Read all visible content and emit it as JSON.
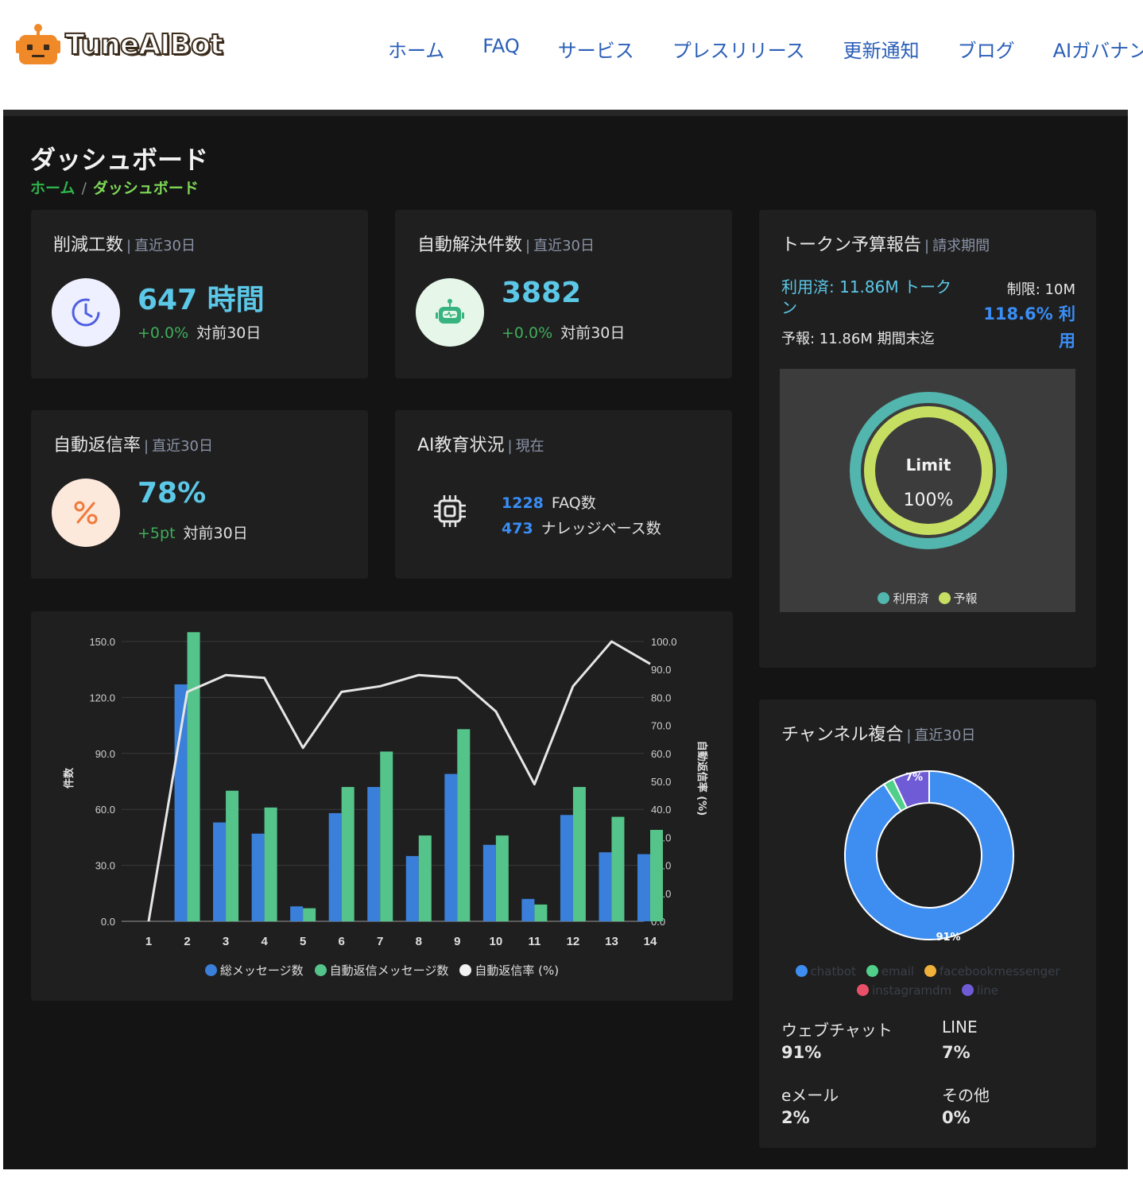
{
  "brand": {
    "name": "TuneAIBot"
  },
  "nav": [
    "ホーム",
    "FAQ",
    "サービス",
    "プレスリリース",
    "更新通知",
    "ブログ",
    "AIガバナン"
  ],
  "page": {
    "title": "ダッシュボード",
    "breadcrumb": {
      "home": "ホーム",
      "sep": "/",
      "current": "ダッシュボード"
    }
  },
  "cards": {
    "reduced_hours": {
      "title": "削減工数",
      "sep": "|",
      "period": "直近30日",
      "value": "647 時間",
      "delta": "+0.0%",
      "delta_label": "対前30日"
    },
    "auto_resolved": {
      "title": "自動解決件数",
      "sep": "|",
      "period": "直近30日",
      "value": "3882",
      "delta": "+0.0%",
      "delta_label": "対前30日"
    },
    "auto_reply_rate": {
      "title": "自動返信率",
      "sep": "|",
      "period": "直近30日",
      "value": "78%",
      "delta": "+5pt",
      "delta_label": "対前30日"
    },
    "ai_training": {
      "title": "AI教育状況",
      "sep": "|",
      "period": "現在",
      "faq_count": "1228",
      "faq_label": "FAQ数",
      "kb_count": "473",
      "kb_label": "ナレッジベース数"
    }
  },
  "token": {
    "title": "トークン予算報告",
    "sep": "|",
    "period": "請求期間",
    "used_line1": "利用済: 11.86M トーク",
    "used_line2": "ン",
    "forecast": "予報: 11.86M 期間末迄",
    "limit": "制限: 10M",
    "usage_line1": "118.6% 利",
    "usage_line2": "用",
    "gauge_label": "Limit",
    "gauge_value": "100%",
    "legend": [
      {
        "label": "利用済",
        "color": "#52b5ae"
      },
      {
        "label": "予報",
        "color": "#c6df62"
      }
    ]
  },
  "channels": {
    "title": "チャンネル複合",
    "sep": "|",
    "period": "直近30日",
    "slice_labels": {
      "chatbot": "91%",
      "line": "7%"
    },
    "stats": [
      {
        "label": "ウェブチャット",
        "value": "91%"
      },
      {
        "label": "LINE",
        "value": "7%"
      },
      {
        "label": "eメール",
        "value": "2%"
      },
      {
        "label": "その他",
        "value": "0%"
      }
    ]
  },
  "chart_data": [
    {
      "type": "bar",
      "categories": [
        "1",
        "2",
        "3",
        "4",
        "5",
        "6",
        "7",
        "8",
        "9",
        "10",
        "11",
        "12",
        "13",
        "14"
      ],
      "series": [
        {
          "name": "総メッセージ数",
          "type": "bar",
          "axis": "left",
          "color": "#3a7fd9",
          "values": [
            0,
            127,
            53,
            47,
            8,
            58,
            72,
            35,
            79,
            41,
            12,
            57,
            37,
            36
          ]
        },
        {
          "name": "自動返信メッセージ数",
          "type": "bar",
          "axis": "left",
          "color": "#55c48a",
          "values": [
            0,
            155,
            70,
            61,
            7,
            72,
            91,
            46,
            103,
            46,
            9,
            72,
            56,
            49
          ]
        },
        {
          "name": "自動返信率 (%)",
          "type": "line",
          "axis": "right",
          "color": "#e6e6e6",
          "values": [
            0,
            82,
            88,
            87,
            62,
            82,
            84,
            88,
            87,
            75,
            49,
            84,
            100,
            92
          ]
        }
      ],
      "ylabel": "件数",
      "y2label": "自動返信率 (%)",
      "ylim": [
        0,
        150
      ],
      "y2lim": [
        0,
        100
      ],
      "yticks": [
        "0.0",
        "30.0",
        "60.0",
        "90.0",
        "120.0",
        "150.0"
      ],
      "y2ticks": [
        "0.0",
        "10.0",
        "20.0",
        "30.0",
        "40.0",
        "50.0",
        "60.0",
        "70.0",
        "80.0",
        "90.0",
        "100.0"
      ],
      "grid": true,
      "legend": "bottom"
    },
    {
      "type": "pie",
      "labels": [
        "chatbot",
        "email",
        "facebookmessenger",
        "instagramdm",
        "line"
      ],
      "values": [
        91,
        2,
        0,
        0,
        7
      ],
      "colors": [
        "#3d8ef0",
        "#50d08a",
        "#f0b13a",
        "#e8506a",
        "#6f5bd6"
      ],
      "legend": "bottom"
    },
    {
      "type": "pie",
      "labels": [
        "利用済",
        "予報"
      ],
      "values": [
        100,
        100
      ],
      "colors": [
        "#52b5ae",
        "#c6df62"
      ],
      "legend": "bottom"
    }
  ]
}
